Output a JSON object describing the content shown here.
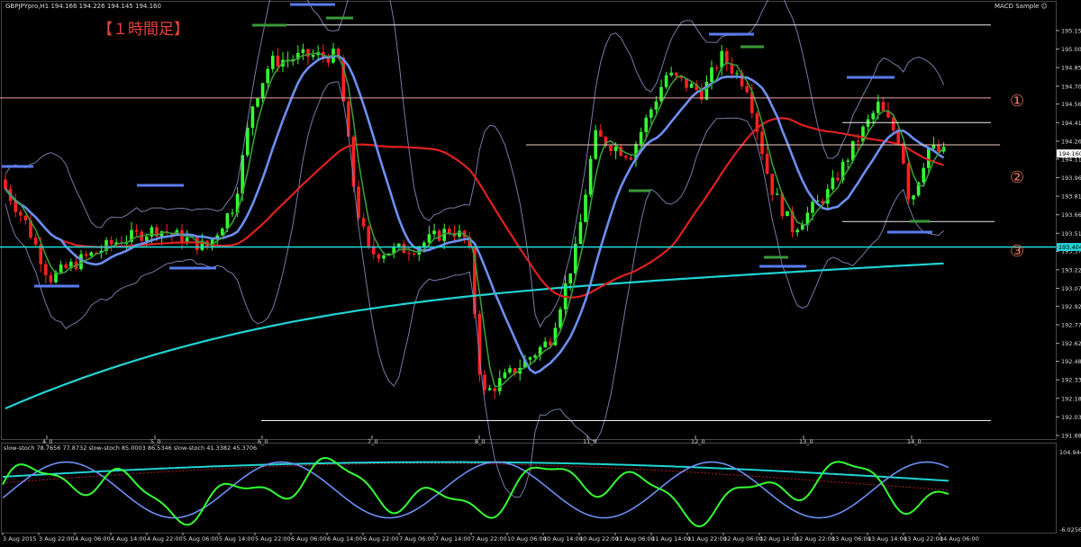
{
  "header": {
    "symbol_info": "GBPJPYpro,H1  194.166 194.226 194.145 194.160",
    "indicator_name": "MACD Sample ☺",
    "annotation": "【１時間足】",
    "stoch_info": "slow-stoch 78.7656 77.8732  slow-stoch 85.0003 86.5346  slow-stoch 41.3382 45.3706"
  },
  "circle_labels": [
    "①",
    "②",
    "③"
  ],
  "colors": {
    "background": "#000000",
    "bull": "#33ff33",
    "bear": "#ff2020",
    "ma_fast": "#3a9a3a",
    "ma_mid": "#6c8ff2",
    "ma_slow": "#e02020",
    "ma_long": "#22d3d3",
    "bands": "#8891c6",
    "annotation": "#e8413a",
    "circle_label": "#e8755a",
    "axis_text": "#dddddd"
  },
  "chart_data": [
    {
      "type": "candlestick",
      "title": "GBPJPYpro,H1",
      "y_ticks": [
        "195.155",
        "195.005",
        "194.855",
        "194.705",
        "194.560",
        "194.410",
        "194.260",
        "194.115",
        "193.965",
        "193.815",
        "193.665",
        "193.515",
        "193.370",
        "193.220",
        "193.070",
        "192.925",
        "192.775",
        "192.625",
        "192.480",
        "192.330",
        "192.180",
        "192.030",
        "191.880"
      ],
      "ylim": [
        191.88,
        195.3
      ],
      "x_ticks": [
        "4_0",
        "5_0",
        "6_0",
        "7_0",
        "8_0",
        "11_0",
        "12_0",
        "13_0",
        "14_0"
      ],
      "current_price": "194.160",
      "line_price": "193.404",
      "horizontal_levels": [
        195.2,
        194.61,
        194.41,
        194.23,
        193.61,
        193.404,
        192.0
      ],
      "approx_close_path": [
        {
          "x": 0,
          "close": 193.95
        },
        {
          "x": 30,
          "close": 193.58
        },
        {
          "x": 55,
          "close": 193.15
        },
        {
          "x": 90,
          "close": 193.3
        },
        {
          "x": 130,
          "close": 193.45
        },
        {
          "x": 175,
          "close": 193.55
        },
        {
          "x": 230,
          "close": 193.4
        },
        {
          "x": 260,
          "close": 193.75
        },
        {
          "x": 280,
          "close": 194.55
        },
        {
          "x": 300,
          "close": 194.9
        },
        {
          "x": 340,
          "close": 194.95
        },
        {
          "x": 375,
          "close": 194.95
        },
        {
          "x": 395,
          "close": 193.75
        },
        {
          "x": 410,
          "close": 193.35
        },
        {
          "x": 460,
          "close": 193.4
        },
        {
          "x": 500,
          "close": 193.55
        },
        {
          "x": 520,
          "close": 193.45
        },
        {
          "x": 535,
          "close": 192.2
        },
        {
          "x": 570,
          "close": 192.4
        },
        {
          "x": 610,
          "close": 192.65
        },
        {
          "x": 640,
          "close": 193.4
        },
        {
          "x": 660,
          "close": 194.3
        },
        {
          "x": 700,
          "close": 194.15
        },
        {
          "x": 740,
          "close": 194.8
        },
        {
          "x": 780,
          "close": 194.65
        },
        {
          "x": 800,
          "close": 194.95
        },
        {
          "x": 830,
          "close": 194.7
        },
        {
          "x": 855,
          "close": 193.9
        },
        {
          "x": 880,
          "close": 193.55
        },
        {
          "x": 920,
          "close": 193.85
        },
        {
          "x": 950,
          "close": 194.25
        },
        {
          "x": 975,
          "close": 194.55
        },
        {
          "x": 1000,
          "close": 194.25
        },
        {
          "x": 1010,
          "close": 193.75
        },
        {
          "x": 1030,
          "close": 194.2
        },
        {
          "x": 1050,
          "close": 194.16
        }
      ],
      "series": [
        {
          "name": "ma_fast",
          "role": "fast moving average"
        },
        {
          "name": "ma_mid",
          "role": "medium moving average"
        },
        {
          "name": "ma_slow",
          "role": "slow moving average"
        },
        {
          "name": "ma_long",
          "role": "long moving average"
        },
        {
          "name": "bands_upper",
          "role": "upper band"
        },
        {
          "name": "bands_lower",
          "role": "lower band"
        }
      ]
    },
    {
      "type": "line",
      "title": "slow-stoch",
      "y_ticks": [
        "104.9441",
        "-6.0256"
      ],
      "ylim": [
        -6.0256,
        104.9441
      ],
      "series": [
        {
          "name": "slow-stoch",
          "last": 78.7656,
          "signal": 77.8732
        },
        {
          "name": "slow-stoch",
          "last": 85.0003,
          "signal": 86.5346
        },
        {
          "name": "slow-stoch",
          "last": 41.3382,
          "signal": 45.3706
        }
      ]
    }
  ],
  "time_axis_labels": [
    "3 Aug 2015",
    "3 Aug 22:00",
    "4 Aug 06:00",
    "4 Aug 14:00",
    "4 Aug 22:00",
    "5 Aug 06:00",
    "5 Aug 14:00",
    "5 Aug 22:00",
    "6 Aug 06:00",
    "6 Aug 14:00",
    "6 Aug 22:00",
    "7 Aug 06:00",
    "7 Aug 14:00",
    "7 Aug 22:00",
    "10 Aug 06:00",
    "10 Aug 14:00",
    "10 Aug 22:00",
    "11 Aug 06:00",
    "11 Aug 14:00",
    "11 Aug 22:00",
    "12 Aug 06:00",
    "12 Aug 14:00",
    "12 Aug 22:00",
    "13 Aug 06:00",
    "13 Aug 14:00",
    "13 Aug 22:00",
    "14 Aug 06:00"
  ]
}
